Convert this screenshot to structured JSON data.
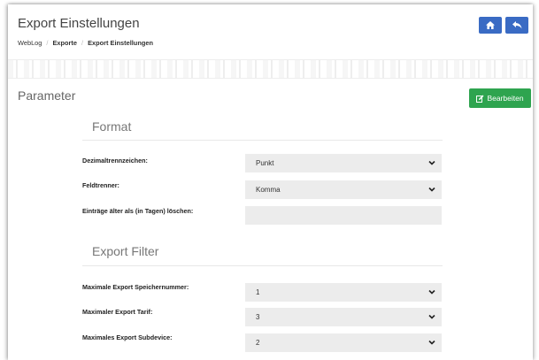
{
  "header": {
    "title": "Export Einstellungen",
    "breadcrumb": [
      "WebLog",
      "Exporte",
      "Export Einstellungen"
    ],
    "buttons": [
      {
        "name": "home",
        "icon": "home-icon"
      },
      {
        "name": "back",
        "icon": "reply-icon"
      }
    ]
  },
  "panel": {
    "title": "Parameter",
    "edit_label": "Bearbeiten",
    "edit_icon": "edit-icon"
  },
  "format": {
    "title": "Format",
    "fields": [
      {
        "label": "Dezimaltrennzeichen:",
        "value": "Punkt"
      },
      {
        "label": "Feldtrenner:",
        "value": "Komma"
      },
      {
        "label": "Einträge älter als (in Tagen) löschen:",
        "value": ""
      }
    ]
  },
  "export_filter": {
    "title": "Export Filter",
    "fields": [
      {
        "label": "Maximale Export Speichernummer:",
        "value": "1"
      },
      {
        "label": "Maximaler Export Tarif:",
        "value": "3"
      },
      {
        "label": "Maximales Export Subdevice:",
        "value": "2"
      }
    ]
  },
  "colors": {
    "primary_blue": "#3a6bc4",
    "success_green": "#2ea44f"
  }
}
